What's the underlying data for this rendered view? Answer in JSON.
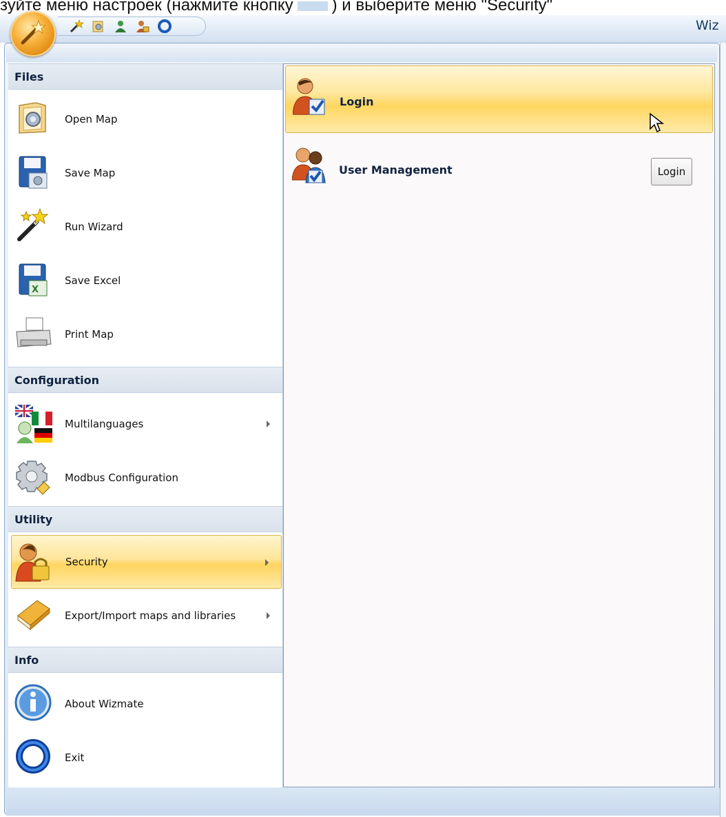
{
  "caption": {
    "before": "зуйте меню настроек (нажмите кнопку",
    "after": ") и выберите меню \"Security\""
  },
  "titlebar": {
    "window_title": "Wiz",
    "qat_icons": [
      "wizard-icon",
      "open-map-icon",
      "user-icon",
      "security-icon",
      "exit-icon"
    ]
  },
  "menu": {
    "sections": [
      {
        "title": "Files"
      },
      {
        "title": "Configuration"
      },
      {
        "title": "Utility"
      },
      {
        "title": "Info"
      }
    ],
    "items": {
      "open_map": "Open Map",
      "save_map": "Save Map",
      "run_wizard": "Run Wizard",
      "save_excel": "Save Excel",
      "print_map": "Print Map",
      "multilanguages": "Multilanguages",
      "modbus_configuration": "Modbus Configuration",
      "security": "Security",
      "export_import": "Export/Import maps and libraries",
      "about": "About Wizmate",
      "exit": "Exit"
    }
  },
  "submenu": {
    "login": "Login",
    "user_management": "User Management",
    "login_button": "Login"
  },
  "colors": {
    "accent_orange": "#f7b13a",
    "highlight_yellow": "#ffd660",
    "frame_blue": "#8aa6c8",
    "header_text": "#10233f"
  }
}
